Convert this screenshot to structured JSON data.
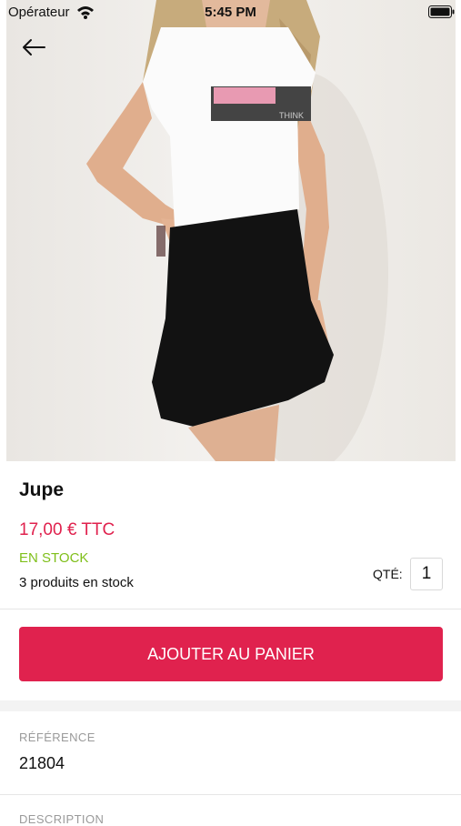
{
  "status_bar": {
    "carrier": "Opérateur",
    "time": "5:45 PM",
    "icons": [
      "wifi-icon",
      "battery-icon"
    ]
  },
  "hero": {
    "image": "product-photo",
    "back_icon": "arrow-left-icon",
    "shirt_print_text": "THINK"
  },
  "product": {
    "title": "Jupe",
    "price": "17,00 € TTC",
    "stock_status": "EN STOCK",
    "stock_count": "3 produits en stock",
    "qty_label": "QTÉ:",
    "qty_value": "1"
  },
  "actions": {
    "add_to_cart": "AJOUTER AU PANIER"
  },
  "details": {
    "reference_label": "RÉFÉRENCE",
    "reference_value": "21804",
    "description_label": "DESCRIPTION"
  },
  "colors": {
    "accent": "#e0224e",
    "stock_green": "#7fbf1a",
    "muted": "#9a9a9a"
  }
}
